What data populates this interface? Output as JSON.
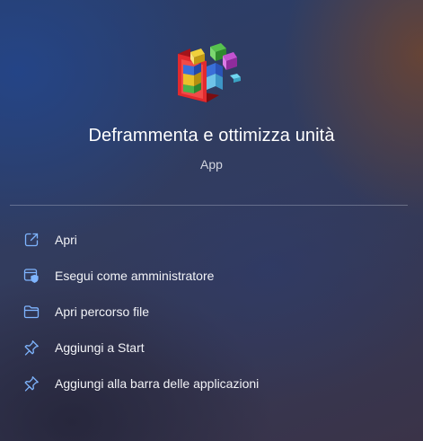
{
  "app": {
    "title": "Deframmenta e ottimizza unità",
    "subtitle": "App",
    "icon": "defragment-icon"
  },
  "menu": {
    "items": [
      {
        "label": "Apri",
        "icon": "open-external-icon"
      },
      {
        "label": "Esegui come amministratore",
        "icon": "run-as-admin-icon"
      },
      {
        "label": "Apri percorso file",
        "icon": "folder-icon"
      },
      {
        "label": "Aggiungi a Start",
        "icon": "pin-icon"
      },
      {
        "label": "Aggiungi alla barra delle applicazioni",
        "icon": "pin-icon"
      }
    ]
  },
  "colors": {
    "accent_icon": "#7fb5ff",
    "text": "#ffffff",
    "subtext": "#d3d6e0"
  }
}
